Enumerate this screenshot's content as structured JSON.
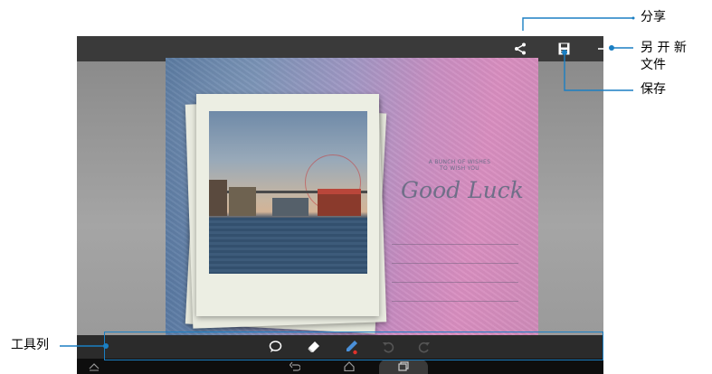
{
  "callouts": {
    "share": "分享",
    "new_file": "另 开 新\n文件",
    "save": "保存",
    "toolbar": "工具列"
  },
  "card": {
    "wish_text_line1": "A BUNCH OF WISHES",
    "wish_text_line2": "TO WISH YOU",
    "title": "Good Luck"
  },
  "icons": {
    "share": "share-icon",
    "save": "save-icon",
    "new": "plus-icon",
    "comment": "speech-bubble-icon",
    "eraser": "eraser-icon",
    "pen": "pen-icon",
    "undo": "undo-icon",
    "redo": "redo-icon",
    "nav_menu": "chevron-up-icon",
    "nav_back": "back-icon",
    "nav_home": "home-icon",
    "nav_recent": "recent-apps-icon"
  },
  "colors": {
    "callout_line": "#1b7fc3",
    "pen_accent": "#e0322a"
  }
}
